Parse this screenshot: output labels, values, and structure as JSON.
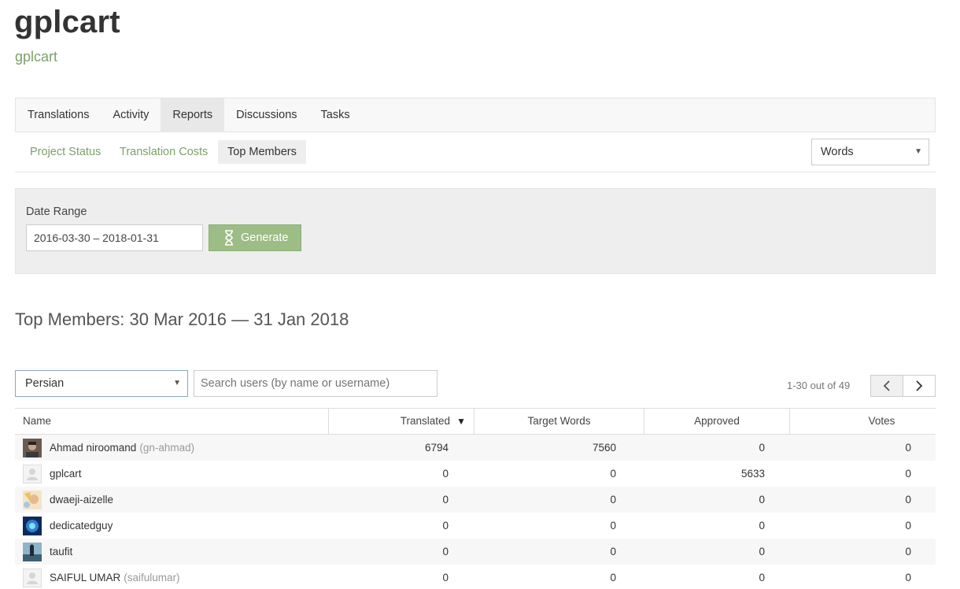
{
  "project": {
    "title": "gplcart",
    "subtitle": "gplcart"
  },
  "main_tabs": [
    {
      "label": "Translations",
      "active": false
    },
    {
      "label": "Activity",
      "active": false
    },
    {
      "label": "Reports",
      "active": true
    },
    {
      "label": "Discussions",
      "active": false
    },
    {
      "label": "Tasks",
      "active": false
    }
  ],
  "sub_tabs": [
    {
      "label": "Project Status",
      "active": false
    },
    {
      "label": "Translation Costs",
      "active": false
    },
    {
      "label": "Top Members",
      "active": true
    }
  ],
  "metric_select": {
    "value": "Words"
  },
  "filter": {
    "date_label": "Date Range",
    "date_value": "2016-03-30 – 2018-01-31",
    "generate_label": "Generate"
  },
  "report_heading": "Top Members: 30 Mar 2016 — 31 Jan 2018",
  "language_select": {
    "value": "Persian"
  },
  "search": {
    "placeholder": "Search users (by name or username)"
  },
  "pagination": {
    "info": "1-30 out of 49"
  },
  "table": {
    "headers": {
      "name": "Name",
      "translated": "Translated",
      "target_words": "Target Words",
      "approved": "Approved",
      "votes": "Votes"
    },
    "rows": [
      {
        "name": "Ahmad niroomand",
        "username": "(gn-ahmad)",
        "translated": "6794",
        "target_words": "7560",
        "approved": "0",
        "votes": "0"
      },
      {
        "name": "gplcart",
        "username": "",
        "translated": "0",
        "target_words": "0",
        "approved": "5633",
        "votes": "0"
      },
      {
        "name": "dwaeji-aizelle",
        "username": "",
        "translated": "0",
        "target_words": "0",
        "approved": "0",
        "votes": "0"
      },
      {
        "name": "dedicatedguy",
        "username": "",
        "translated": "0",
        "target_words": "0",
        "approved": "0",
        "votes": "0"
      },
      {
        "name": "taufit",
        "username": "",
        "translated": "0",
        "target_words": "0",
        "approved": "0",
        "votes": "0"
      },
      {
        "name": "SAIFUL UMAR",
        "username": "(saifulumar)",
        "translated": "0",
        "target_words": "0",
        "approved": "0",
        "votes": "0"
      }
    ]
  },
  "colors": {
    "accent_green": "#7da06a",
    "button_green": "#9cbd86",
    "focus_blue": "#87a7c9"
  }
}
